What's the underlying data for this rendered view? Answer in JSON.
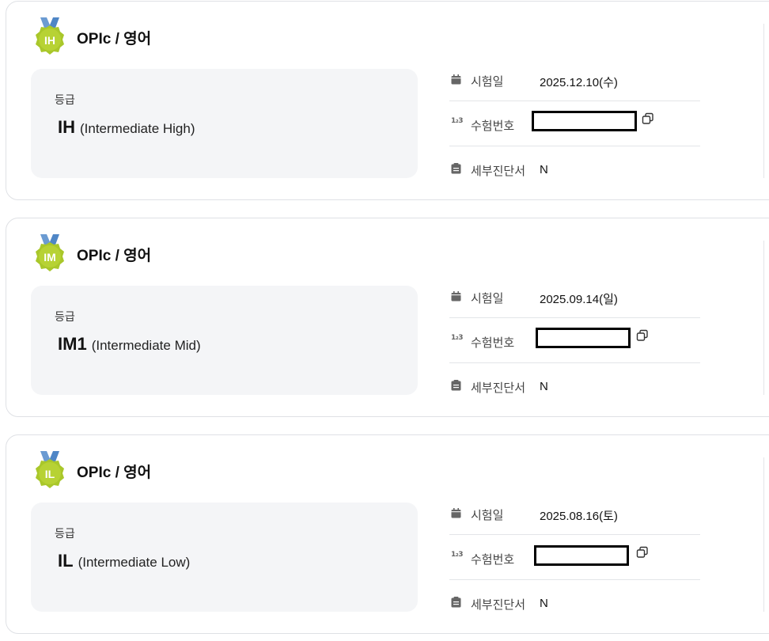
{
  "labels": {
    "grade_label": "등급",
    "exam_date_label": "시험일",
    "exam_number_label": "수험번호",
    "detail_report_label": "세부진단서"
  },
  "colors": {
    "medal_green": "#a9c72a",
    "medal_ribbon": "#6b9bd2",
    "grade_box_bg": "#f4f5f7",
    "redaction": "#000000"
  },
  "records": [
    {
      "title": "OPIc / 영어",
      "badge": "IH",
      "grade": "IH",
      "grade_desc": "(Intermediate High)",
      "exam_date": "2025.12.10(수)",
      "detail_report": "N"
    },
    {
      "title": "OPIc / 영어",
      "badge": "IM",
      "grade": "IM1",
      "grade_desc": "(Intermediate Mid)",
      "exam_date": "2025.09.14(일)",
      "detail_report": "N"
    },
    {
      "title": "OPIc / 영어",
      "badge": "IL",
      "grade": "IL",
      "grade_desc": "(Intermediate Low)",
      "exam_date": "2025.08.16(토)",
      "detail_report": "N"
    }
  ]
}
